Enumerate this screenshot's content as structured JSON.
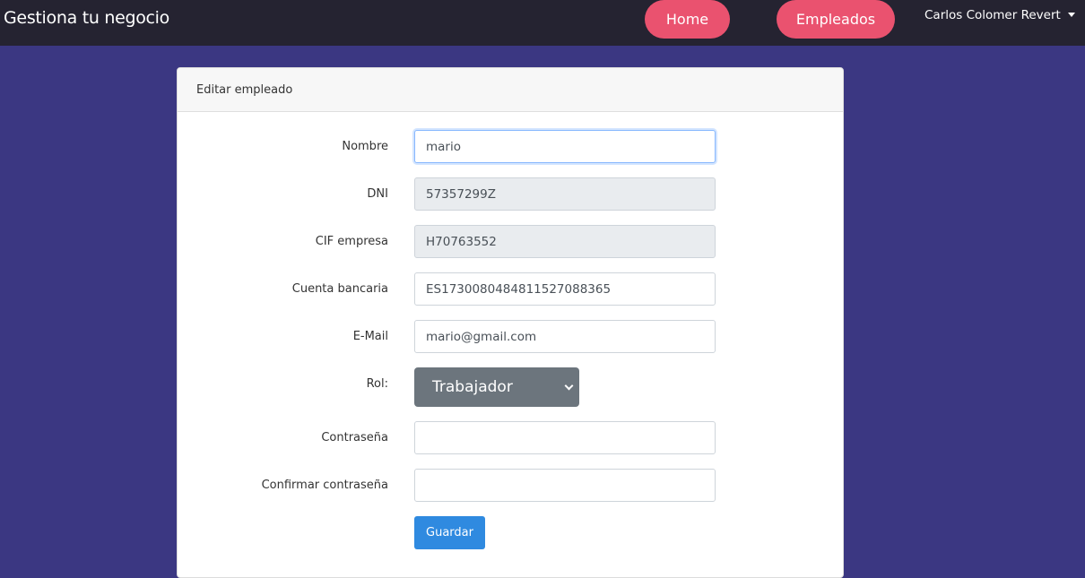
{
  "navbar": {
    "brand": "Gestiona tu negocio",
    "home": "Home",
    "empleados": "Empleados",
    "user": "Carlos Colomer Revert"
  },
  "card": {
    "title": "Editar empleado"
  },
  "form": {
    "nombre": {
      "label": "Nombre",
      "value": "mario"
    },
    "dni": {
      "label": "DNI",
      "value": "57357299Z"
    },
    "cif": {
      "label": "CIF empresa",
      "value": "H70763552"
    },
    "cuenta": {
      "label": "Cuenta bancaria",
      "value": "ES1730080484811527088365"
    },
    "email": {
      "label": "E-Mail",
      "value": "mario@gmail.com"
    },
    "rol": {
      "label": "Rol:",
      "value": "Trabajador"
    },
    "password": {
      "label": "Contraseña",
      "value": ""
    },
    "confirm": {
      "label": "Confirmar contraseña",
      "value": ""
    },
    "submit": "Guardar"
  },
  "colors": {
    "navbar": "#252331",
    "background": "#3b3782",
    "accent_pill": "#ea526f",
    "button_primary": "#2f8ae0",
    "select_bg": "#6c757d"
  }
}
